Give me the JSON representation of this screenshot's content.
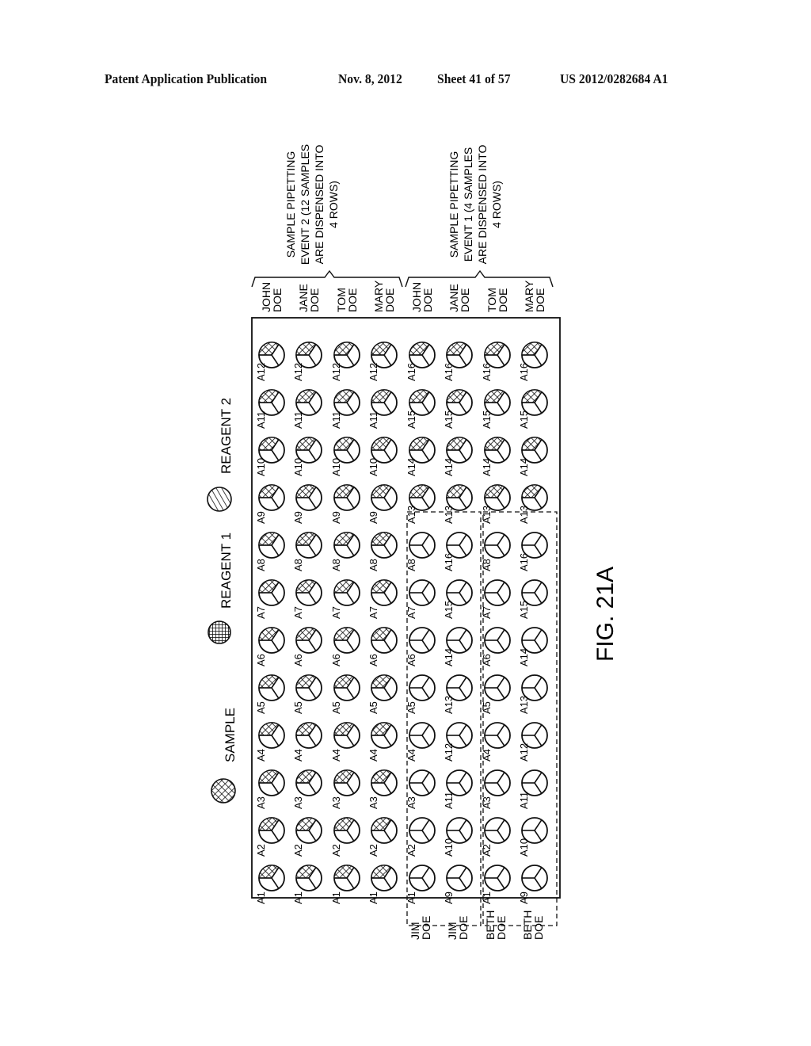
{
  "header": {
    "publication": "Patent Application Publication",
    "date": "Nov. 8, 2012",
    "sheet": "Sheet 41 of 57",
    "number": "US 2012/0282684 A1"
  },
  "legend": [
    {
      "label": "SAMPLE",
      "pattern": "crosshatch-icon"
    },
    {
      "label": "REAGENT 1",
      "pattern": "grid-icon"
    },
    {
      "label": "REAGENT 2",
      "pattern": "diagonal-hatch-icon"
    }
  ],
  "figure_label": "FIG. 21A",
  "events": [
    {
      "lines": [
        "SAMPLE PIPETTING",
        "EVENT 2 (12 SAMPLES",
        "ARE DISPENSED INTO",
        "4 ROWS)"
      ]
    },
    {
      "lines": [
        "SAMPLE PIPETTING",
        "EVENT 1 (4 SAMPLES",
        "ARE DISPENSED INTO",
        "4 ROWS)"
      ]
    }
  ],
  "top_names": [
    [
      "JOHN",
      "DOE"
    ],
    [
      "JANE",
      "DOE"
    ],
    [
      "TOM",
      "DOE"
    ],
    [
      "MARY",
      "DOE"
    ],
    [
      "JOHN",
      "DOE"
    ],
    [
      "JANE",
      "DOE"
    ],
    [
      "TOM",
      "DOE"
    ],
    [
      "MARY",
      "DOE"
    ]
  ],
  "bottom_names": [
    [
      "JIM",
      "DOE"
    ],
    [
      "JIM",
      "DOE"
    ],
    [
      "BETH",
      "DOE"
    ],
    [
      "BETH",
      "DOE"
    ]
  ],
  "rows": [
    {
      "wells": [
        {
          "l": "A1",
          "f": 1
        },
        {
          "l": "A2",
          "f": 1
        },
        {
          "l": "A3",
          "f": 1
        },
        {
          "l": "A4",
          "f": 1
        },
        {
          "l": "A5",
          "f": 1
        },
        {
          "l": "A6",
          "f": 1
        },
        {
          "l": "A7",
          "f": 1
        },
        {
          "l": "A8",
          "f": 1
        },
        {
          "l": "A9",
          "f": 1
        },
        {
          "l": "A10",
          "f": 1
        },
        {
          "l": "A11",
          "f": 1
        },
        {
          "l": "A12",
          "f": 1
        }
      ]
    },
    {
      "wells": [
        {
          "l": "A1",
          "f": 1
        },
        {
          "l": "A2",
          "f": 1
        },
        {
          "l": "A3",
          "f": 1
        },
        {
          "l": "A4",
          "f": 1
        },
        {
          "l": "A5",
          "f": 1
        },
        {
          "l": "A6",
          "f": 1
        },
        {
          "l": "A7",
          "f": 1
        },
        {
          "l": "A8",
          "f": 1
        },
        {
          "l": "A9",
          "f": 1
        },
        {
          "l": "A10",
          "f": 1
        },
        {
          "l": "A11",
          "f": 1
        },
        {
          "l": "A12",
          "f": 1
        }
      ]
    },
    {
      "wells": [
        {
          "l": "A1",
          "f": 1
        },
        {
          "l": "A2",
          "f": 1
        },
        {
          "l": "A3",
          "f": 1
        },
        {
          "l": "A4",
          "f": 1
        },
        {
          "l": "A5",
          "f": 1
        },
        {
          "l": "A6",
          "f": 1
        },
        {
          "l": "A7",
          "f": 1
        },
        {
          "l": "A8",
          "f": 1
        },
        {
          "l": "A9",
          "f": 1
        },
        {
          "l": "A10",
          "f": 1
        },
        {
          "l": "A11",
          "f": 1
        },
        {
          "l": "A12",
          "f": 1
        }
      ]
    },
    {
      "wells": [
        {
          "l": "A1",
          "f": 1
        },
        {
          "l": "A2",
          "f": 1
        },
        {
          "l": "A3",
          "f": 1
        },
        {
          "l": "A4",
          "f": 1
        },
        {
          "l": "A5",
          "f": 1
        },
        {
          "l": "A6",
          "f": 1
        },
        {
          "l": "A7",
          "f": 1
        },
        {
          "l": "A8",
          "f": 1
        },
        {
          "l": "A9",
          "f": 1
        },
        {
          "l": "A10",
          "f": 1
        },
        {
          "l": "A11",
          "f": 1
        },
        {
          "l": "A12",
          "f": 1
        }
      ]
    },
    {
      "wells": [
        {
          "l": "A1",
          "f": 0
        },
        {
          "l": "A2",
          "f": 0
        },
        {
          "l": "A3",
          "f": 0
        },
        {
          "l": "A4",
          "f": 0
        },
        {
          "l": "A5",
          "f": 0
        },
        {
          "l": "A6",
          "f": 0
        },
        {
          "l": "A7",
          "f": 0
        },
        {
          "l": "A8",
          "f": 0
        },
        {
          "l": "A13",
          "f": 1
        },
        {
          "l": "A14",
          "f": 1
        },
        {
          "l": "A15",
          "f": 1
        },
        {
          "l": "A16",
          "f": 1
        }
      ]
    },
    {
      "wells": [
        {
          "l": "A9",
          "f": 0
        },
        {
          "l": "A10",
          "f": 0
        },
        {
          "l": "A11",
          "f": 0
        },
        {
          "l": "A12",
          "f": 0
        },
        {
          "l": "A13",
          "f": 0
        },
        {
          "l": "A14",
          "f": 0
        },
        {
          "l": "A15",
          "f": 0
        },
        {
          "l": "A16",
          "f": 0
        },
        {
          "l": "A13",
          "f": 1
        },
        {
          "l": "A14",
          "f": 1
        },
        {
          "l": "A15",
          "f": 1
        },
        {
          "l": "A16",
          "f": 1
        }
      ]
    },
    {
      "wells": [
        {
          "l": "A1",
          "f": 0
        },
        {
          "l": "A2",
          "f": 0
        },
        {
          "l": "A3",
          "f": 0
        },
        {
          "l": "A4",
          "f": 0
        },
        {
          "l": "A5",
          "f": 0
        },
        {
          "l": "A6",
          "f": 0
        },
        {
          "l": "A7",
          "f": 0
        },
        {
          "l": "A8",
          "f": 0
        },
        {
          "l": "A13",
          "f": 1
        },
        {
          "l": "A14",
          "f": 1
        },
        {
          "l": "A15",
          "f": 1
        },
        {
          "l": "A16",
          "f": 1
        }
      ]
    },
    {
      "wells": [
        {
          "l": "A9",
          "f": 0
        },
        {
          "l": "A10",
          "f": 0
        },
        {
          "l": "A11",
          "f": 0
        },
        {
          "l": "A12",
          "f": 0
        },
        {
          "l": "A13",
          "f": 0
        },
        {
          "l": "A14",
          "f": 0
        },
        {
          "l": "A15",
          "f": 0
        },
        {
          "l": "A16",
          "f": 0
        },
        {
          "l": "A13",
          "f": 1
        },
        {
          "l": "A14",
          "f": 1
        },
        {
          "l": "A15",
          "f": 1
        },
        {
          "l": "A16",
          "f": 1
        }
      ]
    }
  ]
}
